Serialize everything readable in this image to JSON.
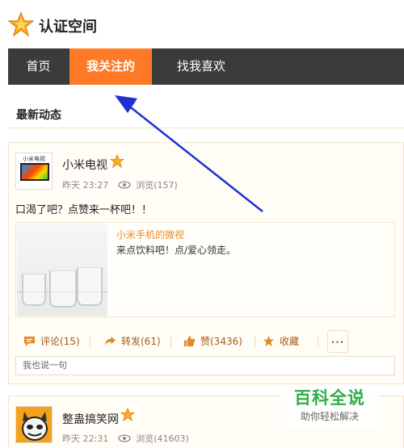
{
  "header": {
    "title": "认证空间",
    "icon": "star-logo-icon"
  },
  "nav": {
    "tabs": [
      {
        "label": "首页"
      },
      {
        "label": "我关注的",
        "active": true
      },
      {
        "label": "找我喜欢"
      }
    ]
  },
  "section": {
    "title": "最新动态"
  },
  "posts": [
    {
      "avatar_caption": "小米电视",
      "author": "小米电视",
      "time": "昨天 23:27",
      "views": "浏览(157)",
      "text": "口渴了吧？点赞来一杯吧！！",
      "quote": {
        "author": "小米手机的微视",
        "text": "来点饮料吧！点/爱心领走。"
      },
      "actions": {
        "comment": "评论(15)",
        "repost": "转发(61)",
        "like": "赞(3436)",
        "favorite": "收藏",
        "more": "···"
      },
      "reply_placeholder": "我也说一句"
    },
    {
      "author": "整蛊搞笑网",
      "time": "昨天 22:31",
      "views": "浏览(41603)"
    }
  ],
  "watermark": {
    "title": "百科全说",
    "subtitle": "助你轻松解决"
  },
  "colors": {
    "accent": "#ff7a26",
    "nav_bg": "#3b3b3b",
    "arrow": "#1f2fd6",
    "watermark_green": "#2fae4a"
  }
}
